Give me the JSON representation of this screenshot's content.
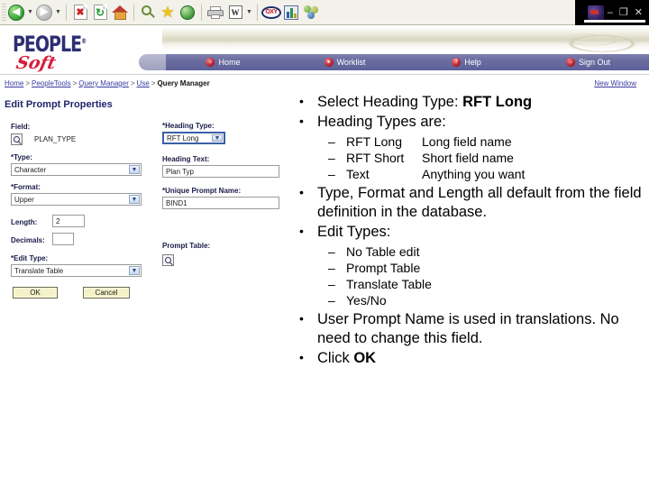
{
  "browser": {
    "toolbar_buttons": [
      {
        "name": "back",
        "label": "Back"
      },
      {
        "name": "back-dropdown",
        "label": "▾"
      },
      {
        "name": "forward",
        "label": "Forward"
      },
      {
        "name": "forward-dropdown",
        "label": "▾"
      },
      {
        "name": "stop",
        "label": "Stop"
      },
      {
        "name": "refresh",
        "label": "Refresh"
      },
      {
        "name": "home",
        "label": "Home"
      },
      {
        "name": "search",
        "label": "Search"
      },
      {
        "name": "favorites",
        "label": "Favorites"
      },
      {
        "name": "history",
        "label": "History"
      },
      {
        "name": "print",
        "label": "Print"
      },
      {
        "name": "edit-word",
        "label": "W"
      },
      {
        "name": "edit-dropdown",
        "label": "▾"
      },
      {
        "name": "oxy",
        "label": "OXY"
      },
      {
        "name": "chart",
        "label": "Chart"
      },
      {
        "name": "groups",
        "label": "Groups"
      }
    ],
    "window_controls": {
      "minimize": "–",
      "restore": "❐",
      "close": "✕"
    }
  },
  "header": {
    "logo_people": "PEOPLE",
    "logo_tm": "®",
    "logo_soft": "Soft",
    "nav": [
      {
        "label": "Home",
        "glyph": "⌂"
      },
      {
        "label": "Worklist",
        "glyph": "●"
      },
      {
        "label": "Help",
        "glyph": "?"
      },
      {
        "label": "Sign Out",
        "glyph": "→"
      }
    ]
  },
  "breadcrumb": {
    "items": [
      "Home",
      "PeopleTools",
      "Query Manager",
      "Use"
    ],
    "separator": ">",
    "current": "Query Manager",
    "new_window": "New Window"
  },
  "form": {
    "title": "Edit Prompt Properties",
    "field_label": "Field:",
    "field_value": "PLAN_TYPE",
    "type_label": "*Type:",
    "type_value": "Character",
    "format_label": "*Format:",
    "format_value": "Upper",
    "length_label": "Length:",
    "length_value": "2",
    "decimals_label": "Decimals:",
    "decimals_value": "",
    "edit_type_label": "*Edit Type:",
    "edit_type_value": "Translate Table",
    "heading_type_label": "*Heading Type:",
    "heading_type_value": "RFT Long",
    "heading_text_label": "Heading Text:",
    "heading_text_value": "Plan Typ",
    "unique_prompt_label": "*Unique Prompt Name:",
    "unique_prompt_value": "BIND1",
    "prompt_table_label": "Prompt Table:",
    "ok_label": "OK",
    "cancel_label": "Cancel"
  },
  "slide": {
    "bullets": [
      {
        "text_before": "Select Heading Type: ",
        "bold": "RFT Long",
        "text_after": ""
      },
      {
        "text_before": "Heading Types are:",
        "bold": "",
        "text_after": "",
        "sub": [
          {
            "term": "RFT Long",
            "desc": "Long field name"
          },
          {
            "term": "RFT Short",
            "desc": "Short field name"
          },
          {
            "term": "Text",
            "desc": "Anything you want"
          }
        ]
      },
      {
        "text_before": "Type, Format and Length all default from the field definition in the database.",
        "bold": "",
        "text_after": ""
      },
      {
        "text_before": "Edit Types:",
        "bold": "",
        "text_after": "",
        "sub": [
          {
            "term": "No Table edit",
            "desc": ""
          },
          {
            "term": "Prompt Table",
            "desc": ""
          },
          {
            "term": "Translate Table",
            "desc": ""
          },
          {
            "term": "Yes/No",
            "desc": ""
          }
        ]
      },
      {
        "text_before": "User Prompt Name is used in translations.  No need to change this field.",
        "bold": "",
        "text_after": ""
      },
      {
        "text_before": "Click ",
        "bold": "OK",
        "text_after": ""
      }
    ]
  },
  "colors": {
    "nav_bar": "#6b6da0",
    "logo_blue": "#2c2f72",
    "logo_red": "#d61c3c",
    "link": "#3a3aa0",
    "button_face": "#f5f2c8"
  }
}
